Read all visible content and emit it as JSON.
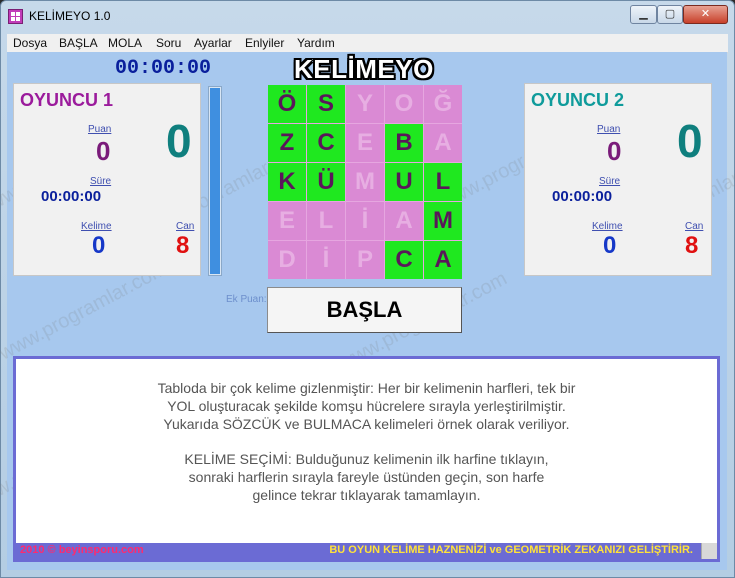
{
  "window": {
    "title": "KELİMEYO 1.0",
    "min": "▁",
    "max": "▢",
    "close": "✕"
  },
  "menu": [
    "Dosya",
    "BAŞLA",
    "MOLA",
    "Soru",
    "Ayarlar",
    "Enlyiler",
    "Yardım"
  ],
  "timer": "00:00:00",
  "logo": "KELİMEYO",
  "players": [
    {
      "name": "OYUNCU 1",
      "name_color": "#9b1b9c",
      "big_score": "0",
      "puan_label": "Puan",
      "puan": "0",
      "sure_label": "Süre",
      "sure": "00:00:00",
      "kelime_label": "Kelime",
      "kelime": "0",
      "can_label": "Can",
      "can": "8"
    },
    {
      "name": "OYUNCU 2",
      "name_color": "#0f9b9b",
      "big_score": "0",
      "puan_label": "Puan",
      "puan": "0",
      "sure_label": "Süre",
      "sure": "00:00:00",
      "kelime_label": "Kelime",
      "kelime": "0",
      "can_label": "Can",
      "can": "8"
    }
  ],
  "progress_fraction": 1.0,
  "grid": [
    [
      [
        "Ö",
        1
      ],
      [
        "S",
        1
      ],
      [
        "Y",
        0
      ],
      [
        "O",
        0
      ],
      [
        "Ğ",
        0
      ]
    ],
    [
      [
        "Z",
        1
      ],
      [
        "C",
        1
      ],
      [
        "E",
        0
      ],
      [
        "B",
        1
      ],
      [
        "A",
        0
      ]
    ],
    [
      [
        "K",
        1
      ],
      [
        "Ü",
        1
      ],
      [
        "M",
        0
      ],
      [
        "U",
        1
      ],
      [
        "L",
        1
      ]
    ],
    [
      [
        "E",
        0
      ],
      [
        "L",
        0
      ],
      [
        "İ",
        0
      ],
      [
        "A",
        0
      ],
      [
        "M",
        1
      ]
    ],
    [
      [
        "D",
        0
      ],
      [
        "İ",
        0
      ],
      [
        "P",
        0
      ],
      [
        "C",
        1
      ],
      [
        "A",
        1
      ]
    ]
  ],
  "ek_puan_label": "Ek Puan:",
  "start_button": "BAŞLA",
  "info": {
    "para1": [
      "Tabloda bir çok kelime gizlenmiştir: Her bir kelimenin harfleri, tek bir",
      "YOL oluşturacak şekilde komşu hücrelere sırayla yerleştirilmiştir.",
      "Yukarıda SÖZCÜK ve BULMACA kelimeleri örnek olarak veriliyor."
    ],
    "para2": [
      "KELİME SEÇİMİ: Bulduğunuz kelimenin ilk harfine tıklayın,",
      "sonraki harflerin sırayla fareyle üstünden geçin, son harfe",
      "gelince tekrar tıklayarak tamamlayın."
    ],
    "footer_left": "2010  © beyinsporu.com",
    "footer_right": "BU OYUN KELİME HAZNENİZİ ve GEOMETRİK ZEKANIZI GELİŞTİRİR."
  },
  "watermark": "www.programlar.com"
}
